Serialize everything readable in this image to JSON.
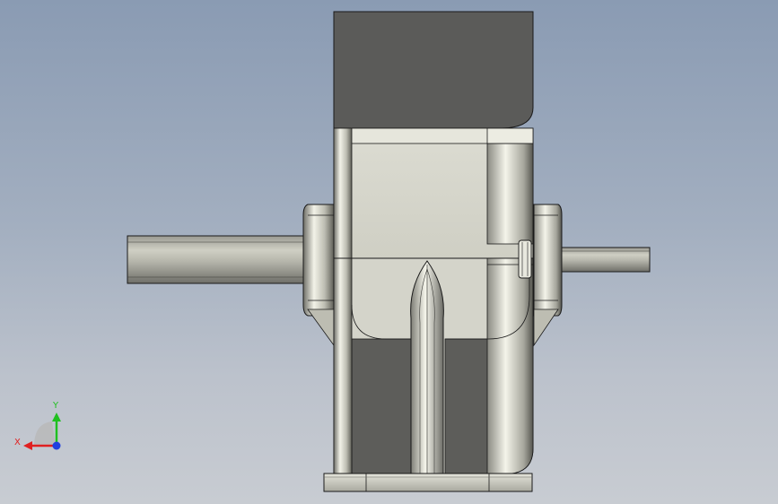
{
  "viewport": {
    "background_top": "#8a9bb3",
    "background_bottom": "#c8ccd2"
  },
  "model": {
    "dark_face": "#5a5a58",
    "body_face": "#d8d8cc",
    "edge": "#1a1a1a"
  },
  "triad": {
    "x_label": "X",
    "y_label": "Y",
    "x_color": "#e02020",
    "y_color": "#20c020",
    "z_color": "#2040e0"
  }
}
